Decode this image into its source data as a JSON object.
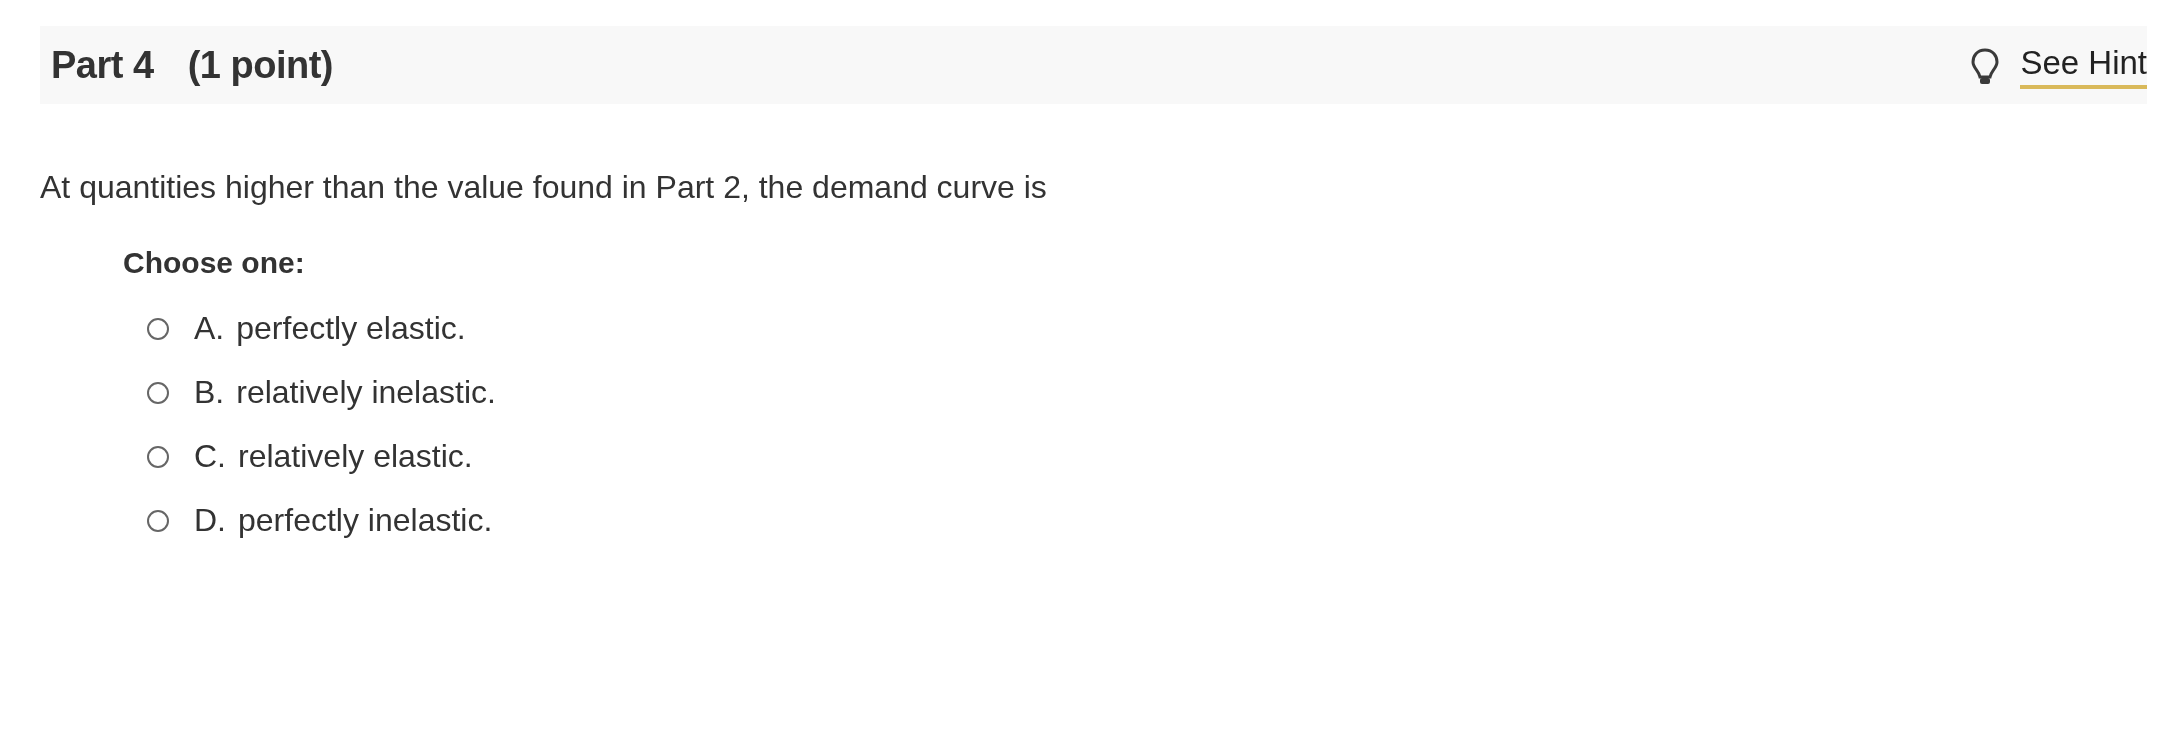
{
  "header": {
    "part": "Part 4",
    "points": "(1 point)",
    "hint_link": "See Hint"
  },
  "question": "At quantities higher than the value found in Part 2, the demand curve is",
  "prompt": "Choose one:",
  "options": [
    {
      "letter": "A.",
      "text": "perfectly elastic.",
      "selected": false
    },
    {
      "letter": "B.",
      "text": "relatively inelastic.",
      "selected": false
    },
    {
      "letter": "C.",
      "text": "relatively elastic.",
      "selected": false
    },
    {
      "letter": "D.",
      "text": "perfectly inelastic.",
      "selected": false
    }
  ]
}
